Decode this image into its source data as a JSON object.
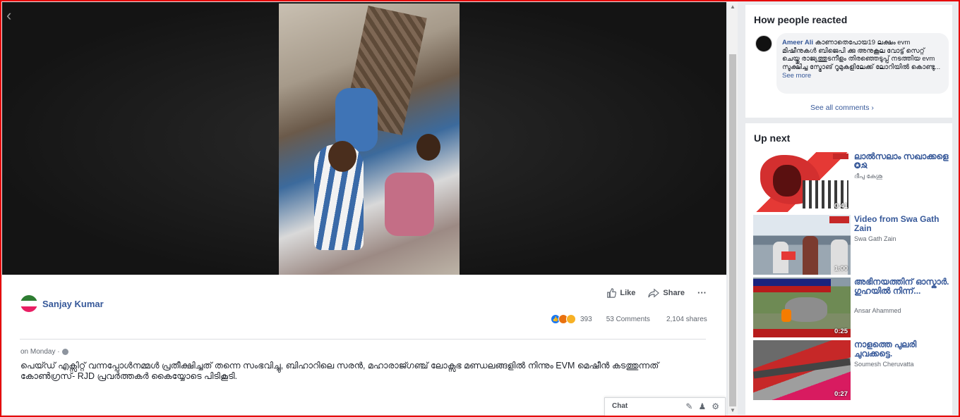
{
  "post": {
    "author": "Sanjay Kumar",
    "actions": {
      "like": "Like",
      "share": "Share",
      "more": "···"
    },
    "reaction_count": "393",
    "comments": "53 Comments",
    "shares": "2,104 shares",
    "time": "on Monday ·",
    "text": "പെയ്ഡ് എക്സിറ്റ് വന്നപ്പോൾനമ്മൾ പ്രതീക്ഷിച്ചത് തന്നെ സംഭവിച്ചു, ബിഹാറിലെ സരൻ, മഹാരാജ്ഗഞ്ച് ലോക്സഭ മണ്ഡലങ്ങളിൽ നിന്നും EVM മെഷീൻ കടത്തുന്നത് കോൺഗ്രസ്- RJD പ്രവർത്തകർ കൈയ്യോടെ പിടികൂടി."
  },
  "chat": {
    "label": "Chat"
  },
  "how_reacted": {
    "title": "How people reacted",
    "comment": {
      "name": "Ameer Ali",
      "text": "കാണാതെപോയ19 ലക്ഷം evm മിഷീനുകൾ ബിജെപി ക്കു അനുകൂല വോട്ട് സെറ്റ് ചെയ്തു രാജ്യത്തുടനീളം തിരഞ്ഞെടുപ്പ് നടത്തിയ evm സൂക്ഷിച്ച സ്ട്രോങ് റൂമുകളിലേക്ക് ലോറിയിൽ കൊണ്ടു...",
      "see_more": "See more"
    },
    "see_all": "See all comments"
  },
  "up_next": {
    "title": "Up next",
    "videos": [
      {
        "title": "ലാൽസലാം സഖാക്കളെ ✪☭",
        "channel": "ദീപു കേശു",
        "duration": "0:41"
      },
      {
        "title": "Video from Swa Gath Zain",
        "channel": "Swa Gath Zain",
        "duration": "1:00"
      },
      {
        "title": "അഭിനയത്തിന് ഓസ്കാർ. ഗുഹയിൽ നിന്ന്...",
        "channel": "Ansar Ahammed",
        "duration": "0:25"
      },
      {
        "title": "നാളത്തെ പുലരി ചുവക്കട്ടെ.",
        "channel": "Soumesh Cheruvatta",
        "duration": "0:27"
      }
    ]
  },
  "icons": {
    "back": "back-arrow-icon",
    "like": "thumbs-up-icon",
    "share": "share-arrow-icon",
    "globe": "globe-icon",
    "compose": "compose-icon",
    "people": "people-icon",
    "settings": "gear-icon"
  },
  "colors": {
    "link": "#365899",
    "border": "#e60000",
    "background": "#e9ebee"
  }
}
